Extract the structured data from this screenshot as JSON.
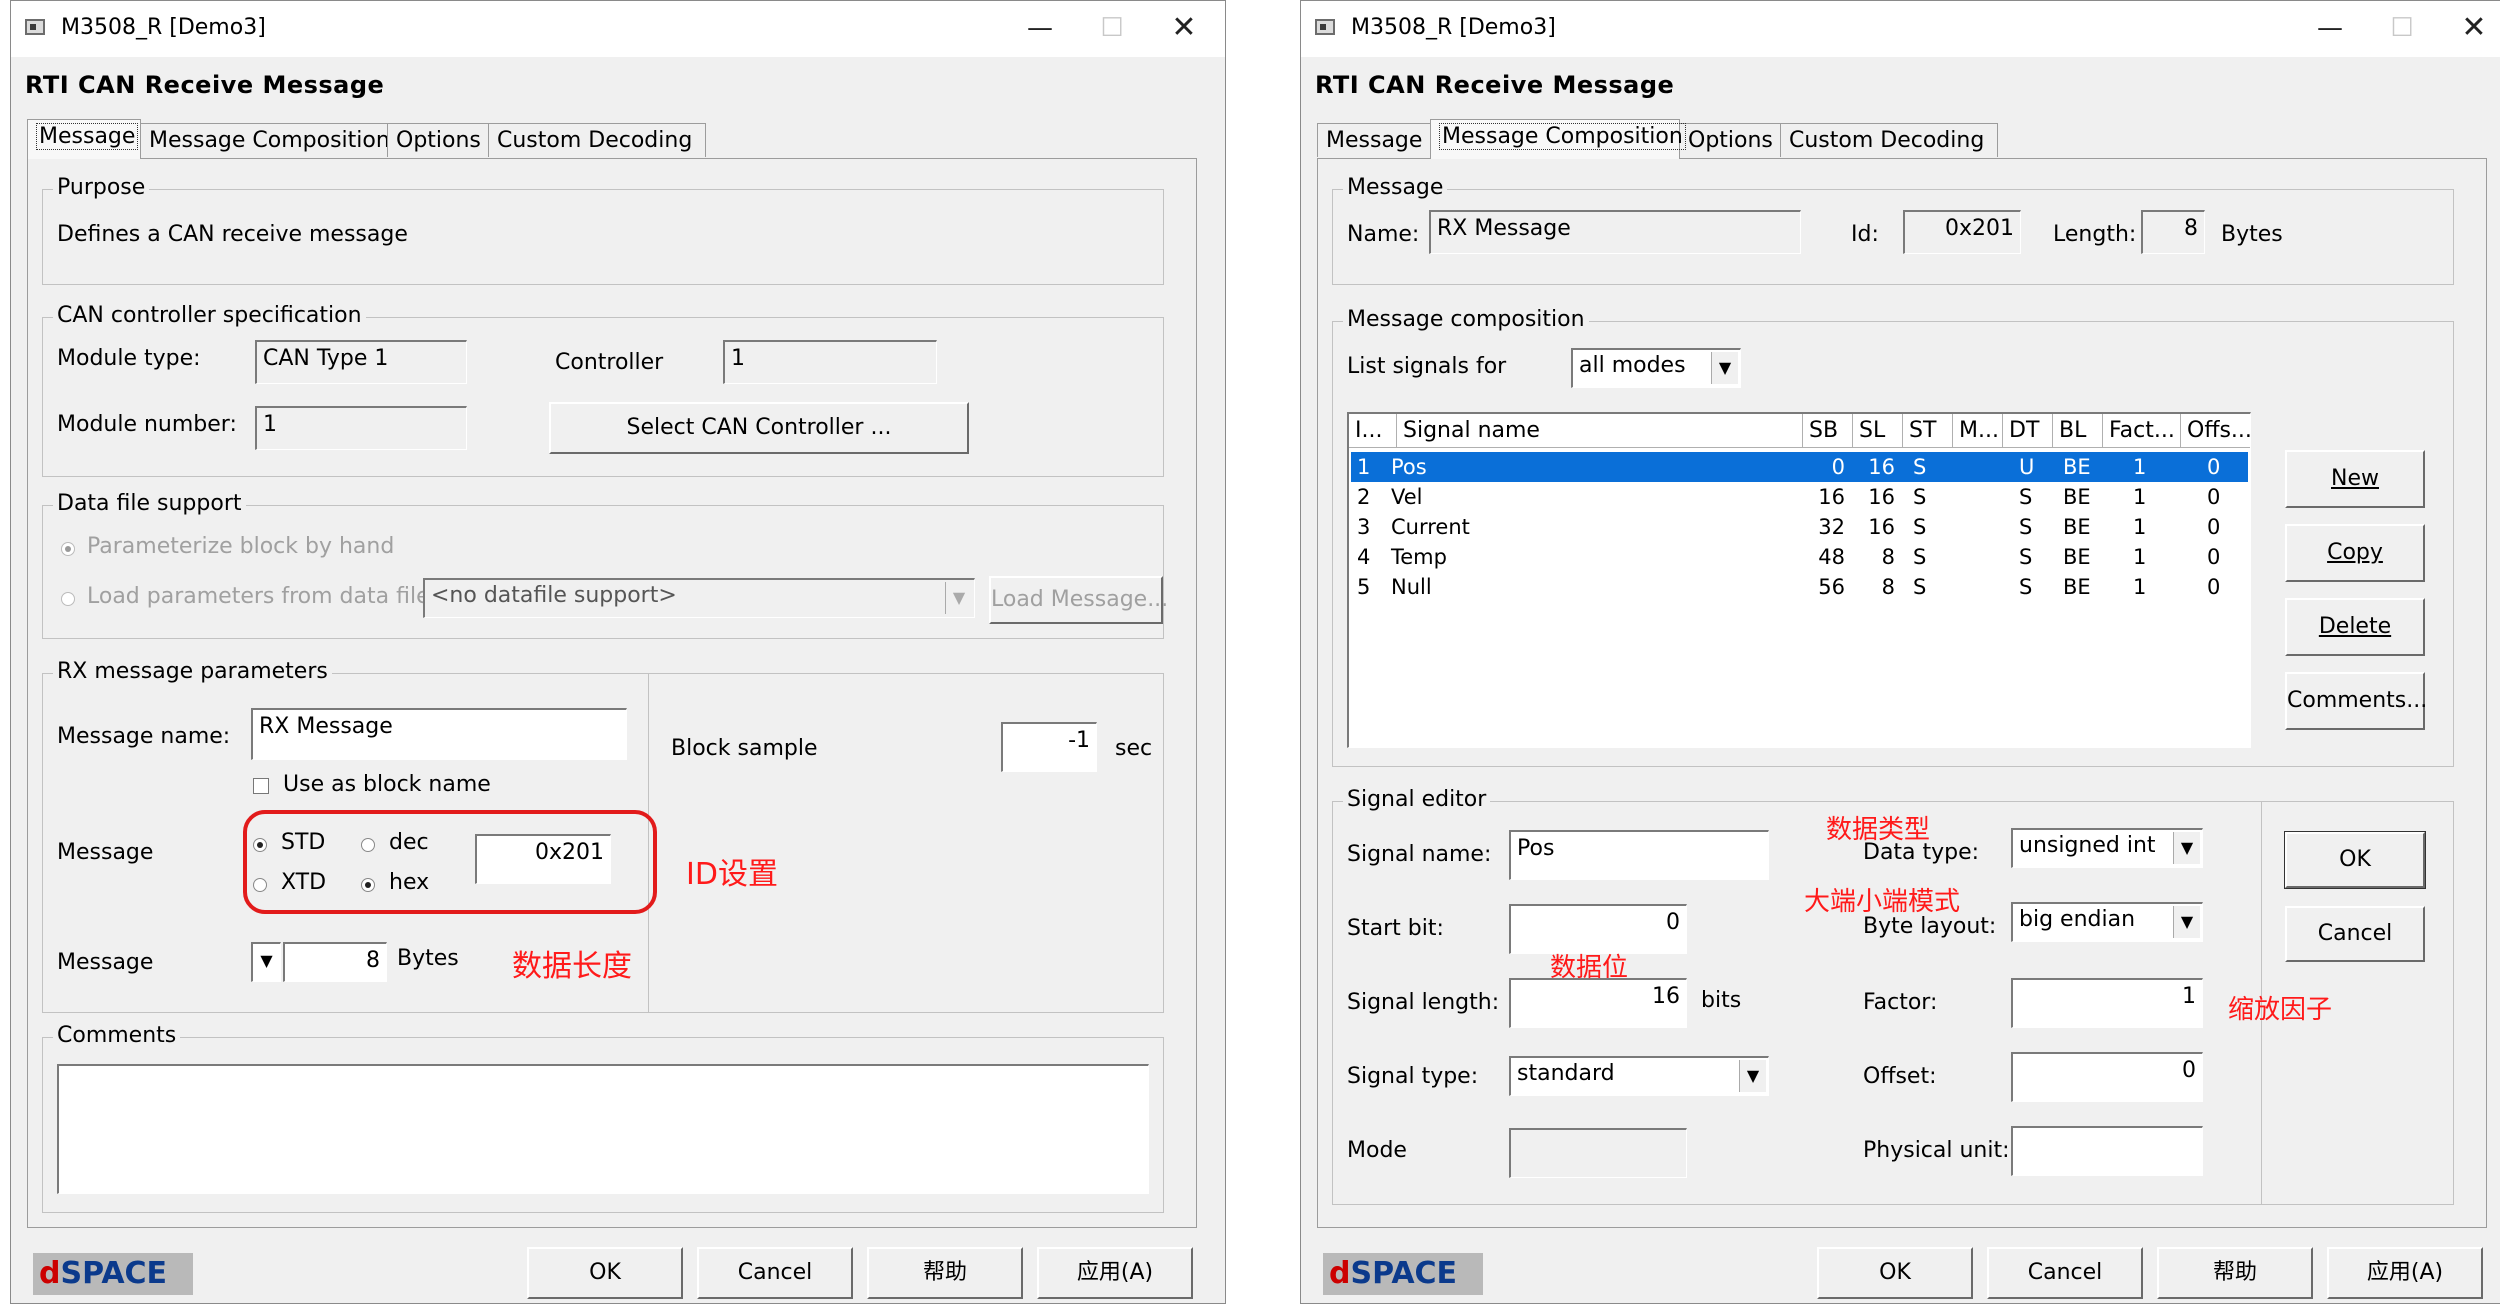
{
  "left": {
    "window_title": "M3508_R  [Demo3]",
    "heading": "RTI CAN  Receive Message",
    "tabs": [
      "Message",
      "Message Composition",
      "Options",
      "Custom Decoding"
    ],
    "purpose": {
      "title": "Purpose",
      "text": "Defines a CAN receive message"
    },
    "can_spec": {
      "title": "CAN controller specification",
      "module_type_label": "Module type:",
      "module_type_value": "CAN Type 1",
      "controller_label": "Controller",
      "controller_value": "1",
      "module_number_label": "Module number:",
      "module_number_value": "1",
      "select_button": "Select CAN Controller ..."
    },
    "datafile": {
      "title": "Data file support",
      "radio_by_hand": "Parameterize block by hand",
      "radio_from_file": "Load parameters from data file",
      "combo_value": "<no datafile support>",
      "load_button": "Load Message..."
    },
    "rx": {
      "title": "RX message parameters",
      "name_label": "Message name:",
      "name_value": "RX Message",
      "use_block_name": "Use as block name",
      "message_label": "Message",
      "std": "STD",
      "xtd": "XTD",
      "dec": "dec",
      "hex": "hex",
      "id_value": "0x201",
      "length_label": "Message",
      "length_value": "8",
      "bytes": "Bytes",
      "block_sample_label": "Block sample",
      "block_sample_value": "-1",
      "sec": "sec"
    },
    "comments_title": "Comments",
    "annotations": {
      "id": "ID设置",
      "length": "数据长度"
    },
    "buttons": {
      "ok": "OK",
      "cancel": "Cancel",
      "help": "帮助",
      "apply": "应用(A)"
    },
    "logo": {
      "d": "d",
      "space": "SPACE"
    }
  },
  "right": {
    "window_title": "M3508_R  [Demo3]",
    "heading": "RTI CAN  Receive Message",
    "tabs": [
      "Message",
      "Message Composition",
      "Options",
      "Custom Decoding"
    ],
    "message_group": {
      "title": "Message",
      "name_label": "Name:",
      "name_value": "RX Message",
      "id_label": "Id:",
      "id_value": "0x201",
      "length_label": "Length:",
      "length_value": "8",
      "bytes": "Bytes"
    },
    "composition": {
      "title": "Message composition",
      "list_label": "List signals for",
      "list_value": "all modes",
      "columns": [
        "I...",
        "Signal name",
        "SB",
        "SL",
        "ST",
        "M...",
        "DT",
        "BL",
        "Fact...",
        "Offs..."
      ],
      "rows": [
        [
          "1",
          "Pos",
          "0",
          "16",
          "S",
          "",
          "U",
          "BE",
          "1",
          "0"
        ],
        [
          "2",
          "Vel",
          "16",
          "16",
          "S",
          "",
          "S",
          "BE",
          "1",
          "0"
        ],
        [
          "3",
          "Current",
          "32",
          "16",
          "S",
          "",
          "S",
          "BE",
          "1",
          "0"
        ],
        [
          "4",
          "Temp",
          "48",
          "8",
          "S",
          "",
          "S",
          "BE",
          "1",
          "0"
        ],
        [
          "5",
          "Null",
          "56",
          "8",
          "S",
          "",
          "S",
          "BE",
          "1",
          "0"
        ]
      ],
      "buttons": {
        "new": "New",
        "copy": "Copy",
        "delete": "Delete",
        "comments": "Comments..."
      }
    },
    "signal_editor": {
      "title": "Signal editor",
      "signal_name_label": "Signal name:",
      "signal_name_value": "Pos",
      "start_bit_label": "Start bit:",
      "start_bit_value": "0",
      "signal_length_label": "Signal length:",
      "signal_length_value": "16",
      "bits": "bits",
      "signal_type_label": "Signal type:",
      "signal_type_value": "standard",
      "mode_label": "Mode",
      "data_type_label": "Data type:",
      "data_type_value": "unsigned int",
      "byte_layout_label": "Byte layout:",
      "byte_layout_value": "big endian",
      "factor_label": "Factor:",
      "factor_value": "1",
      "offset_label": "Offset:",
      "offset_value": "0",
      "physical_unit_label": "Physical unit:",
      "ok": "OK",
      "cancel": "Cancel"
    },
    "annotations": {
      "data_type": "数据类型",
      "byte_layout": "大端小端模式",
      "data_bits": "数据位",
      "scale": "缩放因子"
    },
    "buttons": {
      "ok": "OK",
      "cancel": "Cancel",
      "help": "帮助",
      "apply": "应用(A)"
    },
    "logo": {
      "d": "d",
      "space": "SPACE"
    }
  }
}
